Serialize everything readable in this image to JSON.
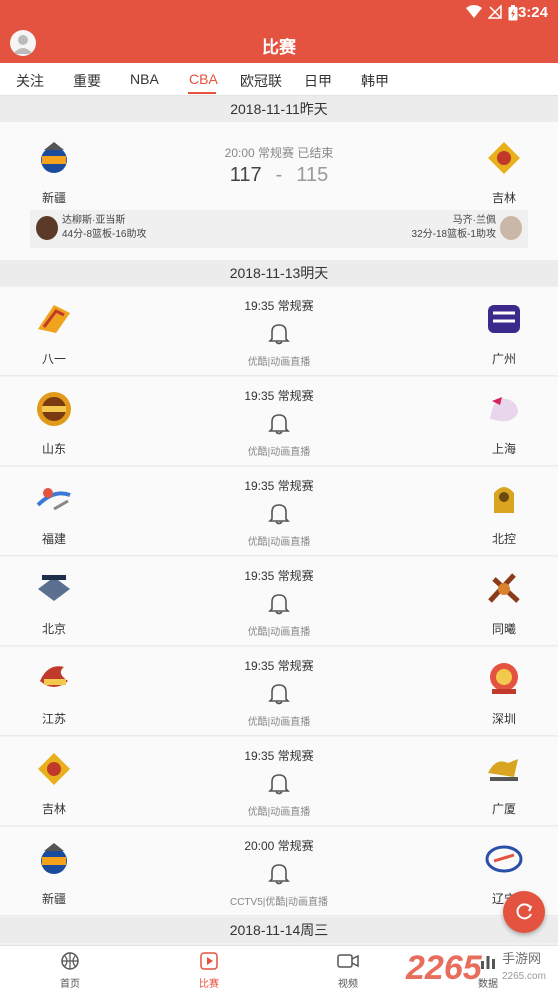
{
  "status_bar": {
    "time": "3:24"
  },
  "app": {
    "title": "比赛"
  },
  "tabs": [
    {
      "label": "关注"
    },
    {
      "label": "重要"
    },
    {
      "label": "NBA"
    },
    {
      "label": "CBA",
      "active": true
    },
    {
      "label": "欧冠联"
    },
    {
      "label": "日甲"
    },
    {
      "label": "韩甲"
    }
  ],
  "days": [
    {
      "date": "2018-11-11昨天",
      "finished_game": {
        "status": "20:00 常规赛 已结束",
        "home": "新疆",
        "away": "吉林",
        "home_score": "117",
        "separator": "-",
        "away_score": "115",
        "home_player_name": "达柳斯·亚当斯",
        "home_player_stats": "44分-8篮板-16助攻",
        "away_player_name": "马齐·兰佩",
        "away_player_stats": "32分-18篮板-1助攻"
      }
    },
    {
      "date": "2018-11-13明天",
      "games": [
        {
          "time": "19:35 常规赛",
          "home": "八一",
          "away": "广州",
          "broadcast": "优酷|动画直播"
        },
        {
          "time": "19:35 常规赛",
          "home": "山东",
          "away": "上海",
          "broadcast": "优酷|动画直播"
        },
        {
          "time": "19:35 常规赛",
          "home": "福建",
          "away": "北控",
          "broadcast": "优酷|动画直播"
        },
        {
          "time": "19:35 常规赛",
          "home": "北京",
          "away": "同曦",
          "broadcast": "优酷|动画直播"
        },
        {
          "time": "19:35 常规赛",
          "home": "江苏",
          "away": "深圳",
          "broadcast": "优酷|动画直播"
        },
        {
          "time": "19:35 常规赛",
          "home": "吉林",
          "away": "广厦",
          "broadcast": "优酷|动画直播"
        },
        {
          "time": "20:00 常规赛",
          "home": "新疆",
          "away": "辽宁",
          "broadcast": "CCTV5|优酷|动画直播"
        }
      ]
    },
    {
      "date": "2018-11-14周三"
    }
  ],
  "bottom_nav": [
    {
      "label": "首页",
      "icon": "basketball-icon"
    },
    {
      "label": "比赛",
      "icon": "play-icon",
      "active": true
    },
    {
      "label": "视频",
      "icon": "video-camera-icon"
    },
    {
      "label": "数据",
      "icon": "bar-chart-icon"
    }
  ],
  "watermark": {
    "brand": "2265",
    "sub": "手游网",
    "domain": "2265.com"
  },
  "colors": {
    "accent": "#e4533f",
    "header_bg": "#ececec",
    "card_bg": "#fafafa"
  }
}
